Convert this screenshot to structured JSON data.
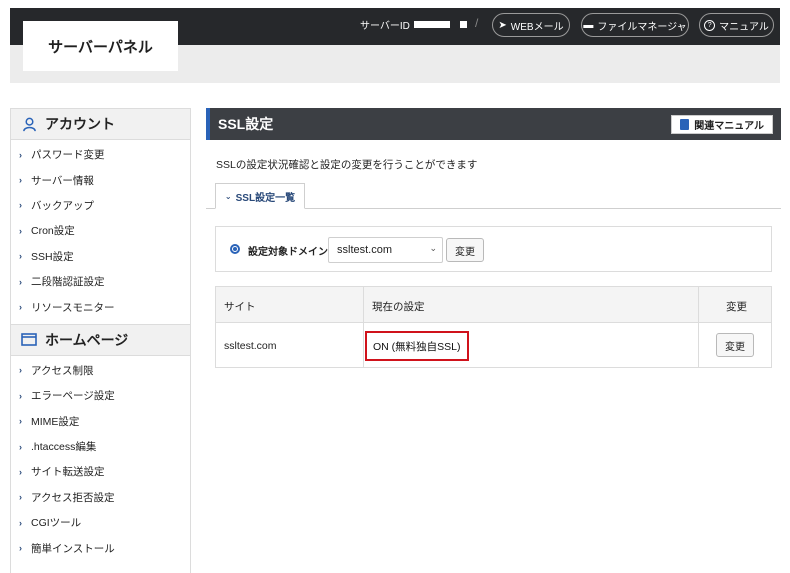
{
  "header": {
    "logo": "サーバーパネル",
    "server_id_label": "サーバーID",
    "buttons": [
      {
        "label": "WEBメール",
        "icon": "send-icon"
      },
      {
        "label": "ファイルマネージャ",
        "icon": "folder-icon"
      },
      {
        "label": "マニュアル",
        "icon": "help-icon"
      }
    ]
  },
  "sidebar": {
    "account_title": "アカウント",
    "account_items": [
      "パスワード変更",
      "サーバー情報",
      "バックアップ",
      "Cron設定",
      "SSH設定",
      "二段階認証設定",
      "リソースモニター"
    ],
    "homepage_title": "ホームページ",
    "homepage_items": [
      "アクセス制限",
      "エラーページ設定",
      "MIME設定",
      ".htaccess編集",
      "サイト転送設定",
      "アクセス拒否設定",
      "CGIツール",
      "簡単インストール"
    ]
  },
  "main": {
    "title": "SSL設定",
    "manual_button": "関連マニュアル",
    "description": "SSLの設定状況確認と設定の変更を行うことができます",
    "tab_label": "SSL設定一覧",
    "domain_label": "設定対象ドメイン",
    "domain_value": "ssltest.com",
    "change_button": "変更",
    "table": {
      "headers": [
        "サイト",
        "現在の設定",
        "変更"
      ],
      "rows": [
        {
          "site": "ssltest.com",
          "status": "ON (無料独自SSL)",
          "action": "変更"
        }
      ]
    }
  },
  "colors": {
    "header_bg": "#26282b",
    "accent": "#2a63b8",
    "highlight": "#d0121b"
  }
}
